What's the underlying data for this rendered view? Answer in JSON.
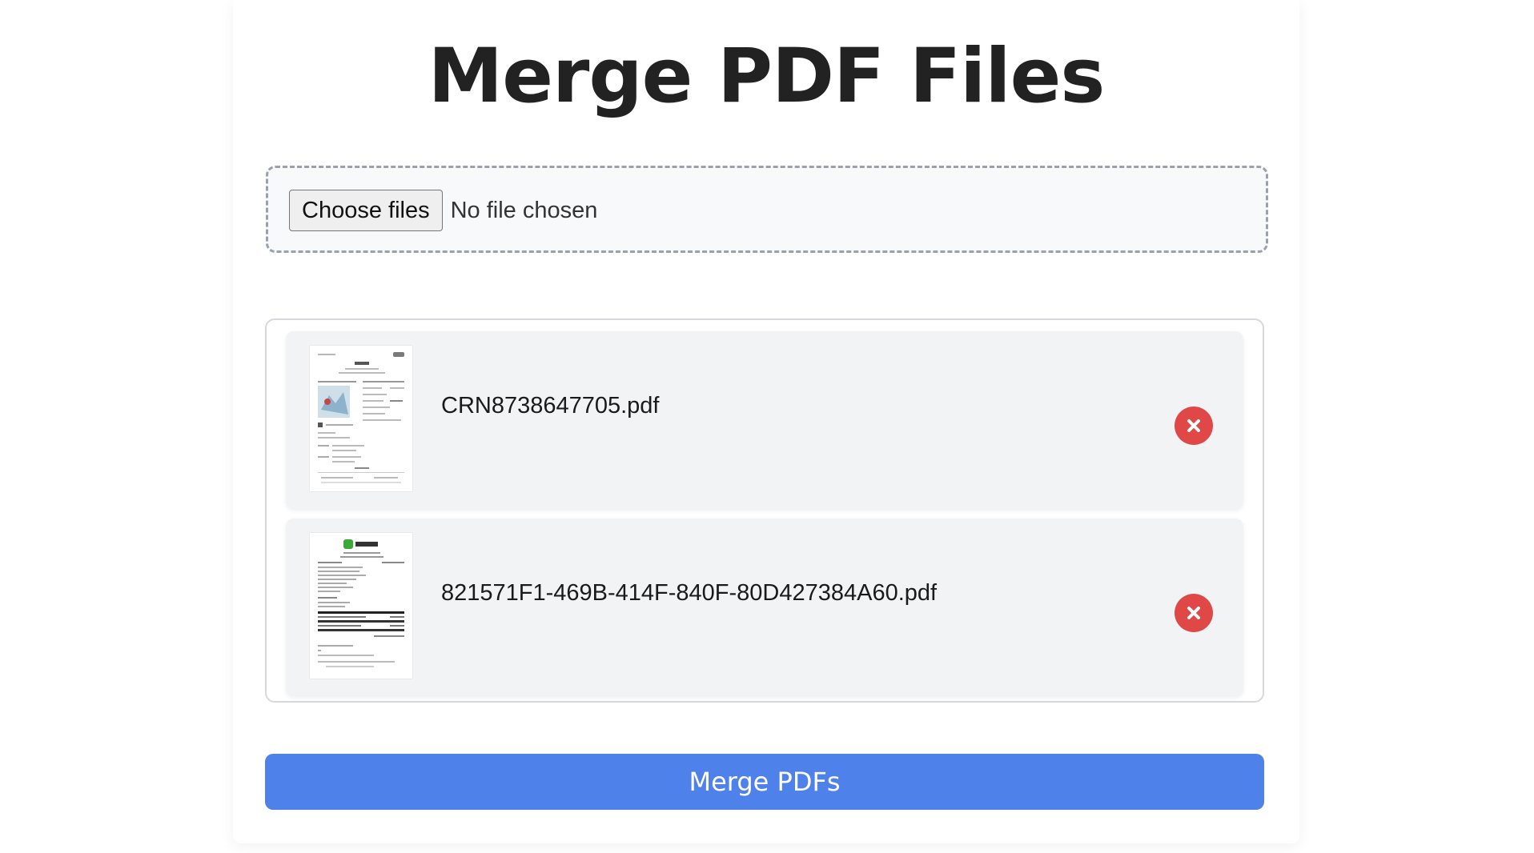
{
  "page": {
    "title": "Merge PDF Files"
  },
  "upload": {
    "button_label": "Choose files",
    "status_text": "No file chosen"
  },
  "files": [
    {
      "name": "CRN8738647705.pdf",
      "thumbnail_icon": "pdf-receipt-thumbnail-icon",
      "remove_icon": "close-icon"
    },
    {
      "name": "821571F1-469B-414F-840F-80D427384A60.pdf",
      "thumbnail_icon": "pdf-invoice-thumbnail-icon",
      "remove_icon": "close-icon"
    }
  ],
  "actions": {
    "merge_label": "Merge PDFs"
  },
  "colors": {
    "accent": "#4f81ea",
    "danger": "#e04848",
    "dropzone_bg": "#f8f9fa",
    "item_bg": "#f2f3f5"
  }
}
